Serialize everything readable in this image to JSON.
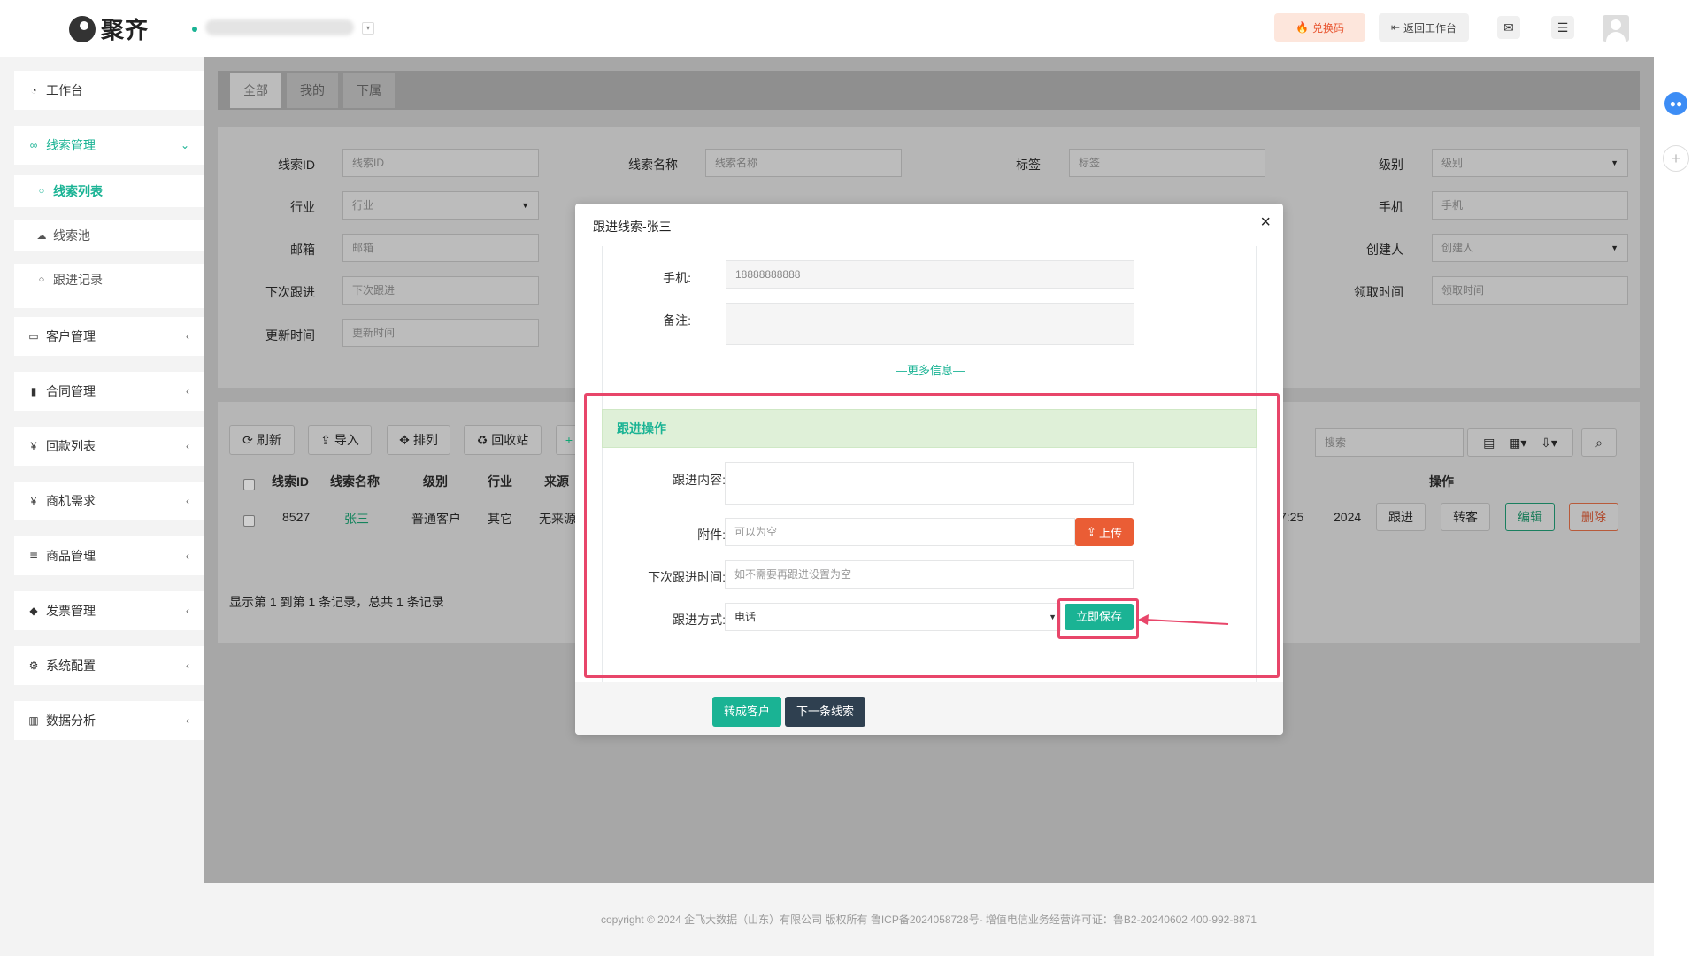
{
  "topbar": {
    "brand": "聚齐",
    "redeem_label": "兑换码",
    "back_label": "返回工作台",
    "mail_icon": "mail-icon",
    "menu_icon": "menu-icon"
  },
  "sidebar": {
    "items": [
      {
        "label": "工作台",
        "icon": "dashboard-icon"
      },
      {
        "label": "线索管理",
        "icon": "link-icon"
      },
      {
        "label": "客户管理",
        "icon": "id-card-icon"
      },
      {
        "label": "合同管理",
        "icon": "bookmark-icon"
      },
      {
        "label": "回款列表",
        "icon": "yen-icon"
      },
      {
        "label": "商机需求",
        "icon": "yen-icon"
      },
      {
        "label": "商品管理",
        "icon": "list-icon"
      },
      {
        "label": "发票管理",
        "icon": "tag-icon"
      },
      {
        "label": "系统配置",
        "icon": "cogs-icon"
      },
      {
        "label": "数据分析",
        "icon": "bar-chart-icon"
      }
    ],
    "sub_items": [
      {
        "label": "线索列表"
      },
      {
        "label": "线索池"
      },
      {
        "label": "跟进记录"
      }
    ]
  },
  "tabs": [
    "全部",
    "我的",
    "下属"
  ],
  "search": {
    "fields": [
      {
        "label": "线索ID",
        "placeholder": "线索ID"
      },
      {
        "label": "线索名称",
        "placeholder": "线索名称"
      },
      {
        "label": "标签",
        "placeholder": "标签"
      },
      {
        "label": "级别",
        "placeholder": "级别"
      },
      {
        "label": "行业",
        "placeholder": "行业"
      },
      {
        "label": "手机",
        "placeholder": "手机"
      },
      {
        "label": "邮箱",
        "placeholder": "邮箱"
      },
      {
        "label": "创建人",
        "placeholder": "创建人"
      },
      {
        "label": "下次跟进",
        "placeholder": "下次跟进"
      },
      {
        "label": "领取时间",
        "placeholder": "领取时间"
      },
      {
        "label": "更新时间",
        "placeholder": "更新时间"
      }
    ]
  },
  "toolbar": {
    "refresh": "刷新",
    "import": "导入",
    "sort": "排列",
    "recycle": "回收站",
    "search_placeholder": "搜索"
  },
  "table": {
    "headers": [
      "线索ID",
      "线索名称",
      "级别",
      "行业",
      "来源",
      "操作"
    ],
    "row": {
      "id": "8527",
      "name": "张三",
      "level": "普通客户",
      "industry": "其它",
      "source": "无来源",
      "time_fragment": "7:25",
      "year_fragment": "2024"
    },
    "ops": [
      "跟进",
      "转客",
      "编辑",
      "删除"
    ],
    "summary": "显示第 1 到第 1 条记录，总共 1 条记录"
  },
  "modal": {
    "title": "跟进线索-张三",
    "phone_label": "手机:",
    "phone_value": "18888888888",
    "note_label": "备注:",
    "more_info": "—更多信息—",
    "section_title": "跟进操作",
    "content_label": "跟进内容:",
    "attachment_label": "附件:",
    "attachment_placeholder": "可以为空",
    "upload_label": "上传",
    "next_time_label": "下次跟进时间:",
    "next_time_placeholder": "如不需要再跟进设置为空",
    "method_label": "跟进方式:",
    "method_value": "电话",
    "save_label": "立即保存",
    "convert_label": "转成客户",
    "next_lead_label": "下一条线索"
  },
  "footer": {
    "text": "copyright © 2024 企飞大数据（山东）有限公司 版权所有   鲁ICP备2024058728号-   增值电信业务经营许可证：鲁B2-20240602   400-992-8871"
  },
  "colors": {
    "accent": "#1ab394",
    "danger": "#ea5d35",
    "highlight": "#e8466a"
  }
}
